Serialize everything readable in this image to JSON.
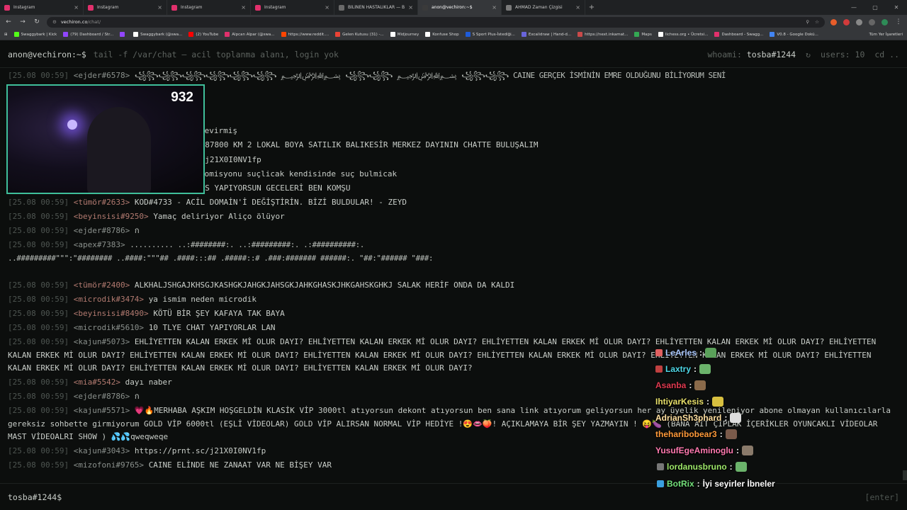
{
  "browser": {
    "tabs": [
      {
        "title": "Instagram",
        "color": "#e1306c",
        "active": false
      },
      {
        "title": "Instagram",
        "color": "#e1306c",
        "active": false
      },
      {
        "title": "Instagram",
        "color": "#e1306c",
        "active": false
      },
      {
        "title": "Instagram",
        "color": "#e1306c",
        "active": false
      },
      {
        "title": "BİLİNEN HASTALIKLAR — Bedir",
        "color": "#6a6a6a",
        "active": false
      },
      {
        "title": "anon@vechiron:~$",
        "color": "#3a3a3a",
        "active": true
      },
      {
        "title": "AHMAD Zaman Çizgisi",
        "color": "#7a7a7a",
        "active": false
      }
    ],
    "url_host": "vechiron.co",
    "url_path": "/chat/",
    "bookmarks": [
      {
        "label": "Swaggybark | Kick",
        "color": "#53fc18"
      },
      {
        "label": "(79) Dashboard / Str...",
        "color": "#9146ff"
      },
      {
        "label": "",
        "color": "#9146ff"
      },
      {
        "label": "Swaggybark (@swa...",
        "color": "#ffffff"
      },
      {
        "label": "(2) YouTube",
        "color": "#ff0000"
      },
      {
        "label": "Alpcan Alpar (@swa...",
        "color": "#e1306c"
      },
      {
        "label": "https://www.reddit....",
        "color": "#ff4500"
      },
      {
        "label": "Gelen Kutusu (31) -...",
        "color": "#ea4335"
      },
      {
        "label": "Midjourney",
        "color": "#ffffff"
      },
      {
        "label": "Konfuse Shop",
        "color": "#ffffff"
      },
      {
        "label": "S Sport Plus-İstediği...",
        "color": "#1e5bd8"
      },
      {
        "label": "Excalidraw | Hand-d...",
        "color": "#6965db"
      },
      {
        "label": "https://next.inkamat...",
        "color": "#c94a4a"
      },
      {
        "label": "Maps",
        "color": "#34a853"
      },
      {
        "label": "lichess.org • Ücretsi...",
        "color": "#ffffff"
      },
      {
        "label": "Dashboard - Swagg...",
        "color": "#e1306c"
      },
      {
        "label": "V0.8 - Google Dokü...",
        "color": "#4285f4"
      }
    ],
    "bookmarks_all": "Tüm Yer İşaretleri"
  },
  "terminal": {
    "prompt": "anon@vechiron:~$",
    "command": "tail -f /var/chat — acil toplanma alanı, login yok",
    "whoami_label": "whoami:",
    "whoami_value": "tosba#1244",
    "refresh_icon": "↻",
    "users_label": "users:",
    "users_value": "10",
    "cd_label": "cd ..",
    "input_prompt": "tosba#1244$",
    "enter_label": "[enter]"
  },
  "chat_lines": [
    {
      "ts": "[25.08 00:59]",
      "nick": "<ejder#6578>",
      "red": false,
      "msg": "꧁꧂꧁꧂꧁꧂꧁꧂꧁꧂꧁꧂ ﷽ ꧁꧂꧁꧂ ﷽ ꧁꧂꧁꧂ CAINE   GERÇEK İSMİNİN EMRE OLDUĞUNU BİLİYORUM SENİ"
    },
    {
      "ts": "",
      "nick": "",
      "red": false,
      "msg": "devirmiş"
    },
    {
      "ts": "",
      "nick": "",
      "red": false,
      "msg": "C 87800 KM 2 LOKAL BOYA SATILIK BALIKESİR MERKEZ DAYININ CHATTE BULUŞALIM"
    },
    {
      "ts": "",
      "nick": "",
      "red": false,
      "msg": "c/j21X0I0NV1fp"
    },
    {
      "ts": "",
      "nick": "",
      "red": false,
      "msg": "komisyonu suçlicak kendisinde suç bulmicak"
    },
    {
      "ts": "",
      "nick": "",
      "red": false,
      "msg": "SES YAPIYORSUN GECELERİ BEN KOMŞU"
    },
    {
      "ts": "[25.08 00:59]",
      "nick": "<tümör#2633>",
      "red": true,
      "msg": "KOD#4733 - ACİL DOMAİN'İ DEĞİŞTİRİN. BİZİ BULDULAR! - ZEYD"
    },
    {
      "ts": "[25.08 00:59]",
      "nick": "<beyinsisi#9250>",
      "red": true,
      "msg": "Yamaç deliriyor Aliço ölüyor"
    },
    {
      "ts": "[25.08 00:59]",
      "nick": "<ejder#8786>",
      "red": false,
      "msg": "ก"
    },
    {
      "ts": "[25.08 00:59]",
      "nick": "<apex#7383>",
      "red": false,
      "msg": "..........          ..:########:.          ..:#########:.          .:##########:."
    },
    {
      "ts": "",
      "nick": "",
      "red": false,
      "msg": "..#########\"\"\":\"########  ..####:\"\"\"##  .####:::##  .#####::#  .###:#######  ######:.  \"##:\"######  \"###:"
    },
    {
      "ts": "[25.08 00:59]",
      "nick": "<tümör#2400>",
      "red": true,
      "msg": "ALKHALJSHGAJKHSGJKASHGKJAHGKJAHSGKJAHKGHASKJHKGAHSKGHKJ SALAK HERİF ONDA DA KALDI"
    },
    {
      "ts": "[25.08 00:59]",
      "nick": "<microdik#3474>",
      "red": true,
      "msg": "ya ismim neden microdik"
    },
    {
      "ts": "[25.08 00:59]",
      "nick": "<beyinsisi#8490>",
      "red": true,
      "msg": "KÖTÜ BİR ŞEY KAFAYA TAK BAYA"
    },
    {
      "ts": "[25.08 00:59]",
      "nick": "<microdik#5610>",
      "red": false,
      "msg": "10 TLYE CHAT YAPIYORLAR LAN"
    },
    {
      "ts": "[25.08 00:59]",
      "nick": "<kajun#5073>",
      "red": false,
      "msg": "EHLİYETTEN KALAN ERKEK Mİ OLUR DAYI? EHLİYETTEN KALAN ERKEK Mİ OLUR DAYI? EHLİYETTEN KALAN ERKEK Mİ OLUR DAYI? EHLİYETTEN KALAN ERKEK Mİ OLUR DAYI? EHLİYETTEN KALAN ERKEK Mİ OLUR DAYI? EHLİYETTEN KALAN ERKEK Mİ OLUR DAYI? EHLİYETTEN KALAN ERKEK Mİ OLUR DAYI? EHLİYETTEN KALAN ERKEK Mİ OLUR DAYI? EHLİYETTEN KALAN ERKEK Mİ OLUR DAYI? EHLİYETTEN KALAN ERKEK Mİ OLUR DAYI? EHLİYETTEN KALAN ERKEK Mİ OLUR DAYI? EHLİYETTEN KALAN ERKEK Mİ OLUR DAYI?"
    },
    {
      "ts": "[25.08 00:59]",
      "nick": "<mia#5542>",
      "red": true,
      "msg": "dayı naber"
    },
    {
      "ts": "[25.08 00:59]",
      "nick": "<ejder#8786>",
      "red": false,
      "msg": "ก"
    },
    {
      "ts": "[25.08 00:59]",
      "nick": "<kajun#5571>",
      "red": false,
      "msg": "💗🔥MERHABA AŞKIM HOŞGELDİN KLASİK VİP 3000tl atıyorsun dekont atıyorsun ben sana link atıyorum geliyorsun her ay üyelik yenileniyor abone olmayan kullanıcılarla gereksiz sohbette girmiyorum GOLD VİP 6000tl (EŞLİ VİDEOLAR) GOLD VİP ALIRSAN NORMAL VİP HEDİYE !😍👄🍑! AÇIKLAMAYA BİR ŞEY YAZMAYIN ! 😝🍆 (BANA AİT ÇIPLAK İÇERİKLER OYUNCAKLI VİDEOLAR MAST VİDEOALRI SHOW ) 💦💦qweqweqe"
    },
    {
      "ts": "[25.08 00:59]",
      "nick": "<kajun#3043>",
      "red": false,
      "msg": "https://prnt.sc/j21X0I0NV1fp"
    },
    {
      "ts": "[25.08 00:59]",
      "nick": "<mizofoni#9765>",
      "red": false,
      "msg": "CAINE ELİNDE NE ZANAAT VAR NE BİŞEY VAR"
    }
  ],
  "webcam": {
    "counter": "932"
  },
  "stream_chat": [
    {
      "user": "LeArles",
      "color": "#a9c8ff",
      "text": "",
      "emote_color": "#5aa05a",
      "badge_color": "#e06060"
    },
    {
      "user": "Laxtry",
      "color": "#4fd9e8",
      "text": "",
      "emote_color": "#6bb36b",
      "badge_color": "#c04040"
    },
    {
      "user": "Asanba",
      "color": "#e03a50",
      "text": "",
      "emote_color": "#8a6a4a",
      "badge_color": ""
    },
    {
      "user": "IhtiyarKesis",
      "color": "#e8e06a",
      "text": "",
      "emote_color": "#d8c040",
      "badge_color": ""
    },
    {
      "user": "AdrianSh3phard",
      "color": "#ffe0a0",
      "text": "",
      "emote_color": "#dddddd",
      "badge_color": ""
    },
    {
      "user": "theharibobear3",
      "color": "#ff9a3a",
      "text": "",
      "emote_color": "#7a5a4a",
      "badge_color": ""
    },
    {
      "user": "YusufEgeAminoglu",
      "color": "#ff7ab0",
      "text": "",
      "emote_color": "#8a7a6a",
      "badge_color": ""
    },
    {
      "user": "lordanusbruno",
      "color": "#9ee86a",
      "text": "",
      "emote_color": "#6bb36b",
      "badge_color": "#777777"
    },
    {
      "user": "BotRix",
      "color": "#73e07a",
      "text": "İyi seyirler İbneler",
      "emote_color": "",
      "badge_color": "#3aa0e0"
    }
  ]
}
